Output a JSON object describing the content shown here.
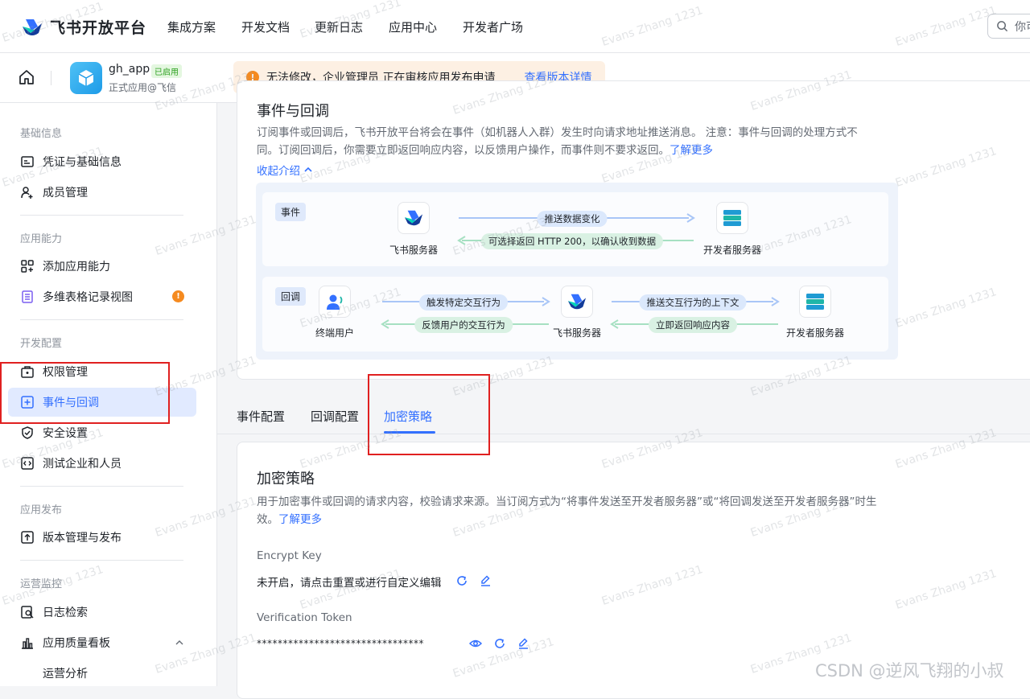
{
  "topnav": {
    "brand": "飞书开放平台",
    "items": [
      "集成方案",
      "开发文档",
      "更新日志",
      "应用中心",
      "开发者广场"
    ],
    "search_placeholder": "你可"
  },
  "appbar": {
    "app_name": "gh_app",
    "status": "已启用",
    "subtitle": "正式应用@飞信",
    "banner_text": "无法修改，企业管理员 正在审核应用发布申请",
    "banner_link": "查看版本详情"
  },
  "sidebar": {
    "sections": [
      {
        "title": "基础信息",
        "items": [
          "凭证与基础信息",
          "成员管理"
        ]
      },
      {
        "title": "应用能力",
        "items": [
          "添加应用能力",
          "多维表格记录视图"
        ]
      },
      {
        "title": "开发配置",
        "items": [
          "权限管理",
          "事件与回调",
          "安全设置",
          "测试企业和人员"
        ]
      },
      {
        "title": "应用发布",
        "items": [
          "版本管理与发布"
        ]
      },
      {
        "title": "运营监控",
        "items": [
          "日志检索",
          "应用质量看板",
          "运营分析"
        ]
      }
    ],
    "badge": "!",
    "active_item": "事件与回调"
  },
  "intro": {
    "title": "事件与回调",
    "desc_line1": "订阅事件或回调后，飞书开放平台将会在事件（如机器人入群）发生时向请求地址推送消息。 注意：事件与回调的处理方式不",
    "desc_line2": "同。订阅回调后，你需要立即返回响应内容，以反馈用户操作，而事件则不要求返回。",
    "learn_more": "了解更多",
    "collapse": "收起介绍"
  },
  "diagram": {
    "event": {
      "tag": "事件",
      "left_node": "飞书服务器",
      "right_node": "开发者服务器",
      "forward": "推送数据变化",
      "back": "可选择返回 HTTP 200，以确认收到数据"
    },
    "callback": {
      "tag": "回调",
      "user_node": "终端用户",
      "mid_node": "飞书服务器",
      "dev_node": "开发者服务器",
      "trigger": "触发特定交互行为",
      "feedback": "反馈用户的交互行为",
      "push_ctx": "推送交互行为的上下文",
      "respond": "立即返回响应内容"
    }
  },
  "tabs": [
    "事件配置",
    "回调配置",
    "加密策略"
  ],
  "active_tab": "加密策略",
  "encrypt": {
    "title": "加密策略",
    "desc_line1": "用于加密事件或回调的请求内容，校验请求来源。当订阅方式为“将事件发送至开发者服务器”或“将回调发送至开发者服务器”时生",
    "desc_line2": "效。",
    "learn_more": "了解更多",
    "encrypt_key_label": "Encrypt Key",
    "encrypt_key_value": "未开启，请点击重置或进行自定义编辑",
    "token_label": "Verification Token",
    "token_value": "********************************"
  },
  "watermark": "Evans Zhang 1231",
  "footer_watermark": "CSDN @逆风飞翔的小叔",
  "colors": {
    "accent": "#3370ff",
    "warn": "#f58a1f",
    "highlight_box": "#e02020",
    "active_bg": "#e1eaff"
  }
}
